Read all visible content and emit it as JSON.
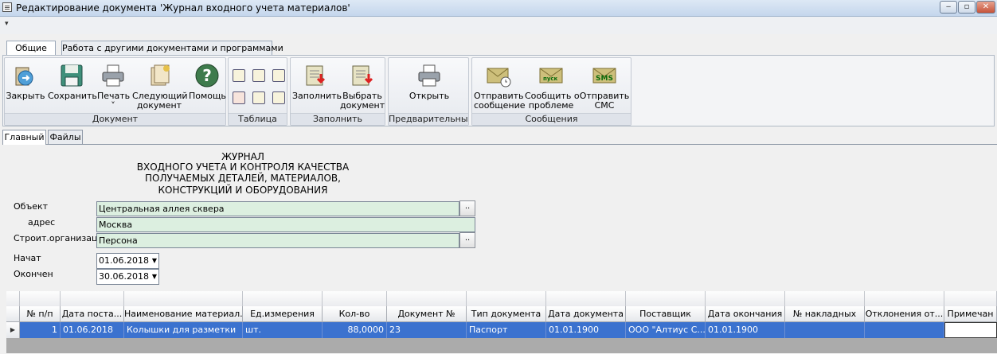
{
  "window": {
    "title": "Редактирование документа 'Журнал входного учета материалов'",
    "min_glyph": "‒",
    "max_glyph": "▫",
    "close_glyph": "✕"
  },
  "qat": {
    "menu_glyph": "▾"
  },
  "ribbon": {
    "tabs": [
      "Общие",
      "Работа с другими документами и программами"
    ],
    "groups": {
      "document": {
        "caption": "Документ",
        "buttons": {
          "close": {
            "l1": "Закрыть",
            "l2": ""
          },
          "save": {
            "l1": "Сохранить",
            "l2": ""
          },
          "print": {
            "l1": "Печать",
            "l2": "˅"
          },
          "next": {
            "l1": "Следующий",
            "l2": "документ"
          },
          "help": {
            "l1": "Помощь",
            "l2": ""
          }
        }
      },
      "table": {
        "caption": "Таблица"
      },
      "fill": {
        "caption": "Заполнить",
        "buttons": {
          "fill": {
            "l1": "Заполнить",
            "l2": ""
          },
          "choose": {
            "l1": "Выбрать",
            "l2": "документ"
          }
        }
      },
      "preview": {
        "caption": "Предварительны...",
        "buttons": {
          "open": {
            "l1": "Открыть",
            "l2": ""
          }
        }
      },
      "messages": {
        "caption": "Сообщения",
        "buttons": {
          "send_msg": {
            "l1": "Отправить",
            "l2": "сообщение"
          },
          "report": {
            "l1": "Сообщить о",
            "l2": "проблеме"
          },
          "sms": {
            "l1": "Отправить",
            "l2": "СМС"
          }
        },
        "badges": {
          "report": "пуск",
          "sms": "SMS"
        }
      }
    }
  },
  "content_tabs": [
    "Главный",
    "Файлы"
  ],
  "header": {
    "line1": "ЖУРНАЛ",
    "line2": "ВХОДНОГО УЧЕТА И КОНТРОЛЯ КАЧЕСТВА",
    "line3": "ПОЛУЧАЕМЫХ ДЕТАЛЕЙ, МАТЕРИАЛОВ,",
    "line4": "КОНСТРУКЦИЙ И ОБОРУДОВАНИЯ"
  },
  "form": {
    "object_label": "Объект",
    "object_value": "Центральная аллея сквера",
    "address_label": "адрес",
    "address_value": "Москва",
    "org_label": "Строит.организация",
    "org_value": "Персона",
    "ellipsis": "..",
    "start_label": "Начат",
    "start_value": "01.06.2018",
    "end_label": "Окончен",
    "end_value": "30.06.2018",
    "dropdown_glyph": "▼"
  },
  "grid": {
    "columns": [
      "№ п/п",
      "Дата поста...",
      "Наименование материал...",
      "Ед.измерения",
      "Кол-во",
      "Документ №",
      "Тип документа",
      "Дата документа",
      "Поставщик",
      "Дата окончания",
      "№ накладных",
      "Отклонения от...",
      "Примечан"
    ],
    "row_indicator": "▶",
    "rows": [
      {
        "num": "1",
        "date": "01.06.2018",
        "name": "Колышки для разметки",
        "unit": "шт.",
        "qty": "88,0000",
        "doc_no": "23",
        "doc_type": "Паспорт",
        "doc_date": "01.01.1900",
        "supplier": "ООО \"Алтиус С...",
        "end_date": "01.01.1900",
        "waybill": "",
        "deviation": "",
        "note": ""
      }
    ]
  },
  "colors": {
    "selection": "#3b72cf",
    "field_green": "#dcefe0"
  }
}
